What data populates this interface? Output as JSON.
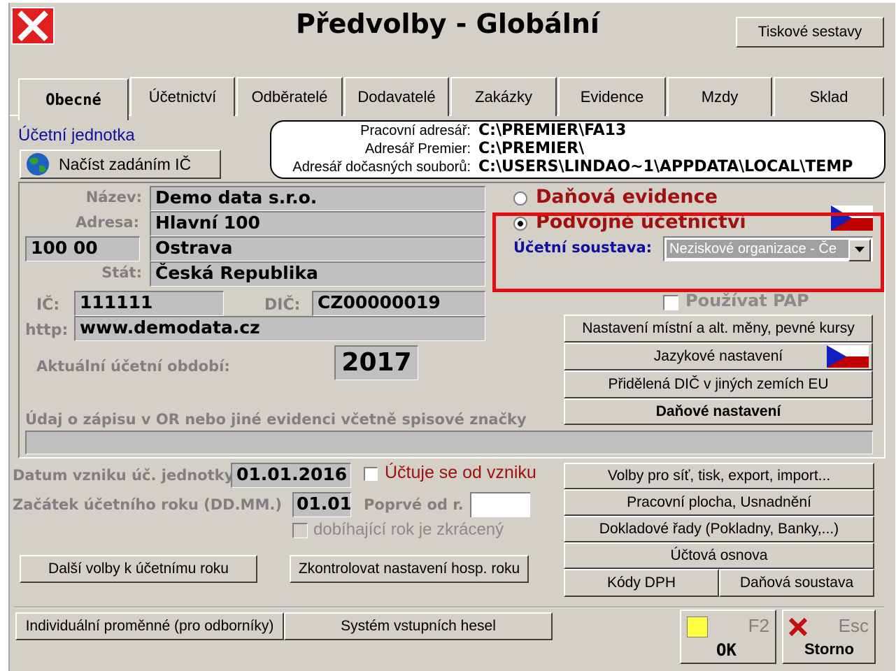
{
  "window": {
    "title": "Předvolby - Globální",
    "print_button": "Tiskové sestavy"
  },
  "tabs": [
    "Obecné",
    "Účetnictví",
    "Odběratelé",
    "Dodavatelé",
    "Zakázky",
    "Evidence",
    "Mzdy",
    "Sklad"
  ],
  "unit": {
    "section_label": "Účetní jednotka",
    "load_by_ic_button": "Načíst zadáním IČ"
  },
  "paths": {
    "working_label": "Pracovní adresář:",
    "working_value": "C:\\PREMIER\\FA13",
    "premier_label": "Adresář Premier:",
    "premier_value": "C:\\PREMIER\\",
    "temp_label": "Adresář dočasných souborů:",
    "temp_value": "C:\\USERS\\LINDAO~1\\APPDATA\\LOCAL\\TEMP"
  },
  "company": {
    "name_label": "Název:",
    "name": "Demo data s.r.o.",
    "address_label": "Adresa:",
    "address": "Hlavní 100",
    "zip": "100 00",
    "city": "Ostrava",
    "country_label": "Stát:",
    "country": "Česká Republika",
    "ic_label": "IČ:",
    "ic": "111111",
    "dic_label": "DIČ:",
    "dic": "CZ00000019",
    "http_label": "http:",
    "http": "www.demodata.cz",
    "period_label": "Aktuální účetní období:",
    "period": "2017",
    "register_label": "Údaj o zápisu v OR nebo jiné  evidenci včetně spisové značky",
    "register_value": ""
  },
  "accounting": {
    "tax_records": "Daňová evidence",
    "double_entry": "Podvojné účetnictví",
    "system_label": "Účetní soustava:",
    "system_value": "Neziskové organizace - Če",
    "use_pap": "Používat PAP"
  },
  "right_buttons": {
    "currency": "Nastavení místní a alt. měny, pevné kursy",
    "language": "Jazykové nastavení",
    "dic_eu": "Přidělená DIČ v jiných zemích EU",
    "tax_settings": "Daňové nastavení",
    "network": "Volby pro síť, tisk, export, import...",
    "desktop": "Pracovní plocha, Usnadnění",
    "doc_series": "Dokladové řady (Pokladny, Banky,...)",
    "chart_accounts": "Účtová osnova",
    "vat_codes": "Kódy DPH",
    "tax_system": "Daňová soustava"
  },
  "year": {
    "founded_label": "Datum vzniku úč. jednotky:",
    "founded": "01.01.2016",
    "since_founding": "Účtuje se od vzniku",
    "start_label": "Začátek účetního roku (DD.MM.)",
    "start": "01.01.",
    "first_label": "Poprvé od r.",
    "first": "",
    "shortened": "dobíhající rok je zkrácený",
    "more_options": "Další volby k účetnímu roku",
    "check_year": "Zkontrolovat nastavení hosp. roku"
  },
  "bottom": {
    "individual": "Individuální proměnné (pro odborníky)",
    "passwords": "Systém vstupních hesel",
    "ok_key": "F2",
    "ok_label": "OK",
    "cancel_key": "Esc",
    "cancel_label": "Storno"
  },
  "colors": {
    "window_bg": "#d4d0c8",
    "accent_red": "#a01010",
    "link_blue": "#1010a0",
    "highlight": "#e01010"
  }
}
